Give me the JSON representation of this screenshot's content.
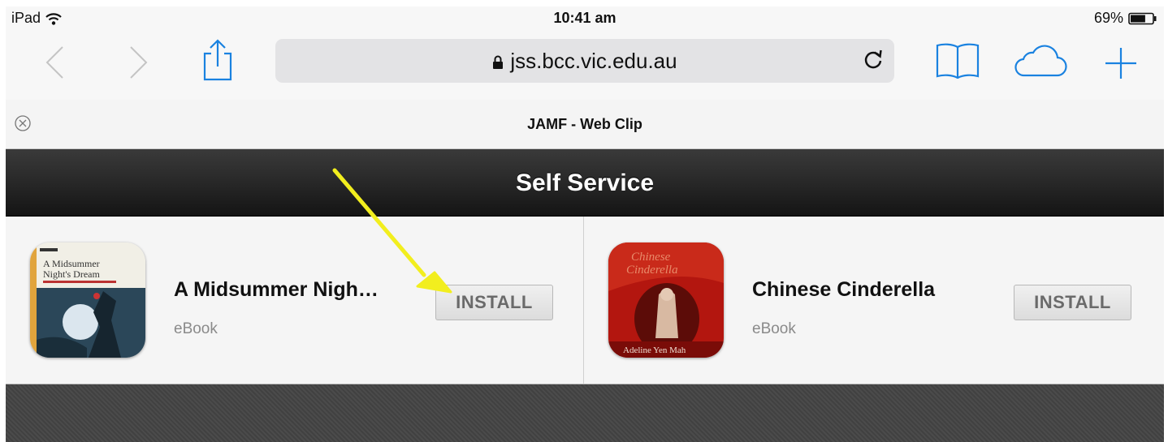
{
  "status_bar": {
    "carrier": "iPad",
    "time": "10:41 am",
    "battery": "69%",
    "battery_level": 0.69
  },
  "browser": {
    "url": "jss.bcc.vic.edu.au",
    "tab_title": "JAMF - Web Clip",
    "tint_color": "#1a82e0",
    "icons": [
      "back-icon",
      "forward-icon",
      "share-icon",
      "lock-icon",
      "reload-icon",
      "bookmarks-icon",
      "cloud-icon",
      "add-tab-icon",
      "close-tab-icon"
    ]
  },
  "app": {
    "title": "Self Service",
    "items": [
      {
        "name": "A Midsummer Nigh…",
        "type": "eBook",
        "button": "INSTALL",
        "cover": "A Midsummer Night's Dream"
      },
      {
        "name": "Chinese Cinderella",
        "type": "eBook",
        "button": "INSTALL",
        "cover": "Chinese Cinderella"
      }
    ]
  },
  "annotation": {
    "arrow_color": "#f2ee1e"
  }
}
